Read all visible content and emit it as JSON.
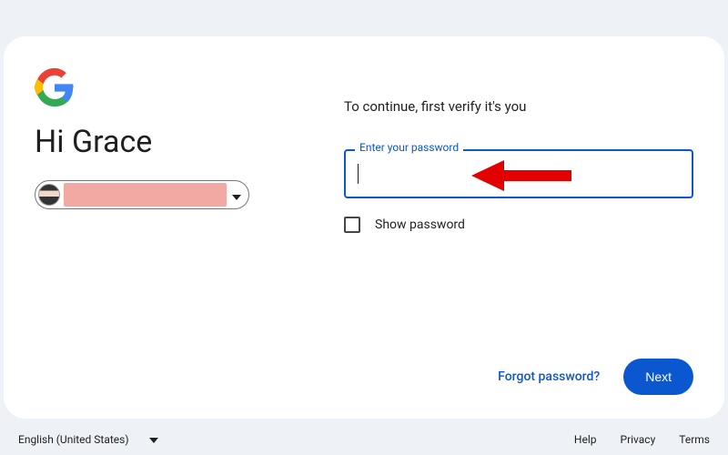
{
  "greeting": "Hi Grace",
  "instruction": "To continue, first verify it's you",
  "passwordField": {
    "label": "Enter your password",
    "value": ""
  },
  "showPasswordLabel": "Show password",
  "forgotLabel": "Forgot password?",
  "nextLabel": "Next",
  "footer": {
    "language": "English (United States)",
    "links": [
      "Help",
      "Privacy",
      "Terms"
    ]
  },
  "colors": {
    "primary": "#0b57d0"
  }
}
